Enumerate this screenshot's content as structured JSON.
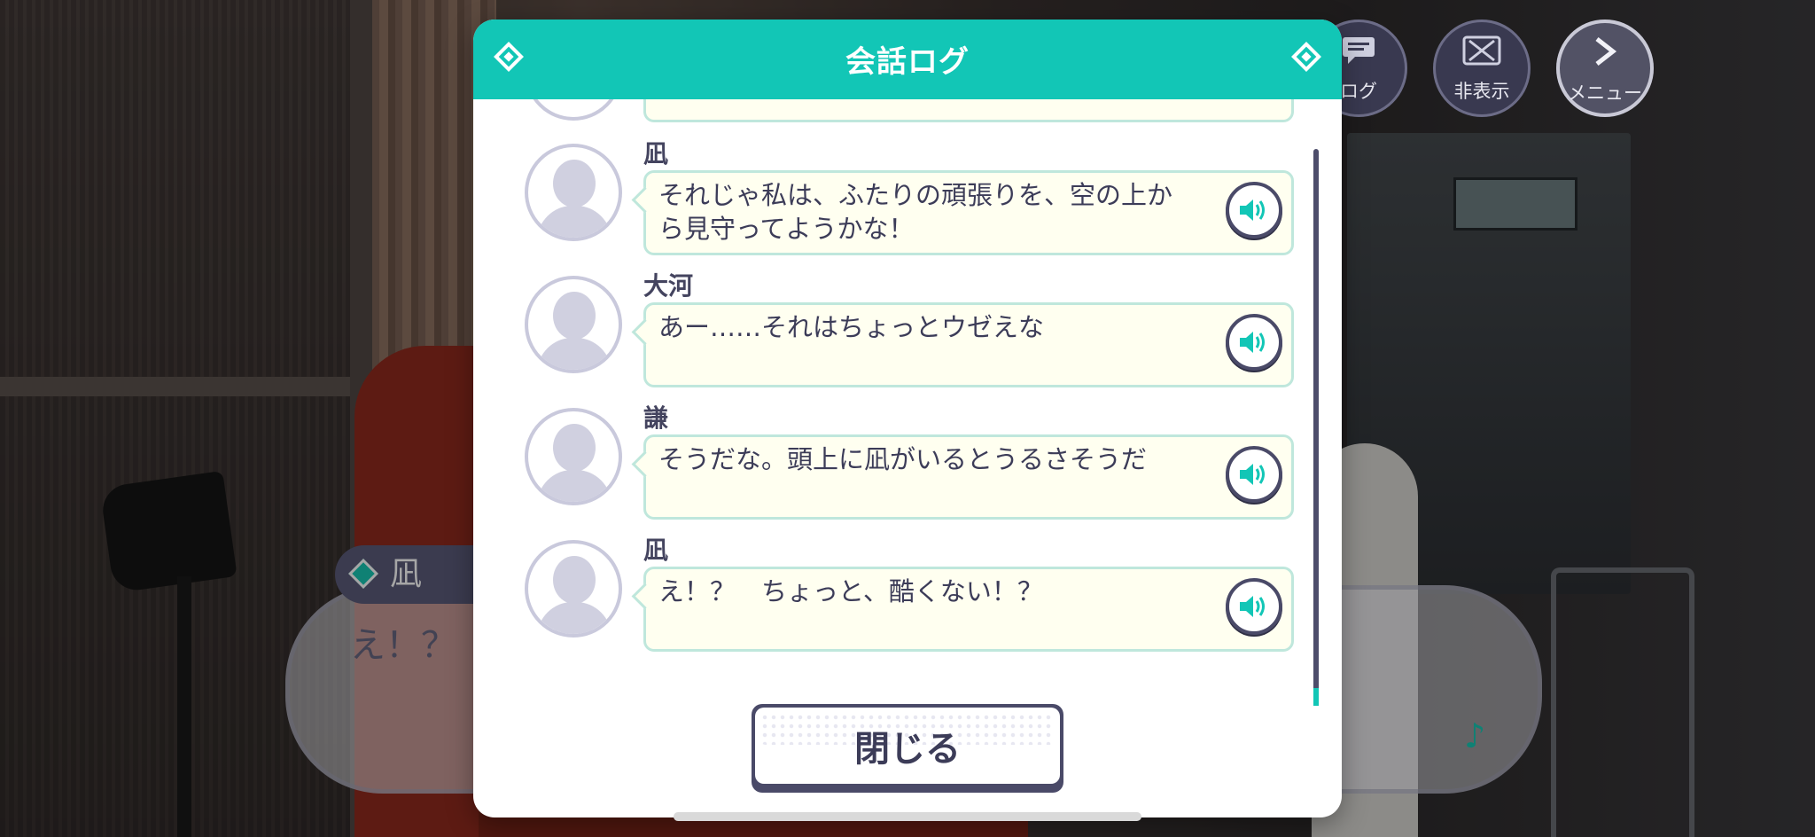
{
  "header_buttons": {
    "log_label": "ログ",
    "hide_label": "非表示",
    "menu_label": "メニュー"
  },
  "dialogue": {
    "speaker": "凪",
    "text": "え！？"
  },
  "modal": {
    "title": "会話ログ",
    "close_label": "閉じる"
  },
  "log_entries": [
    {
      "name": "凪",
      "text": "それじゃ私は、ふたりの頑張りを、空の上から見守ってようかな！"
    },
    {
      "name": "大河",
      "text": "あー……それはちょっとウゼえな"
    },
    {
      "name": "謙",
      "text": "そうだな。頭上に凪がいるとうるさそうだ"
    },
    {
      "name": "凪",
      "text": "え！？　ちょっと、酷くない！？"
    }
  ],
  "colors": {
    "accent": "#12c6b6",
    "dark": "#4a4a68",
    "bubble": "#fffff0"
  },
  "icons": {
    "voice": "speaker-icon",
    "header_deco": "diamond-icon",
    "note": "music-note-icon"
  }
}
